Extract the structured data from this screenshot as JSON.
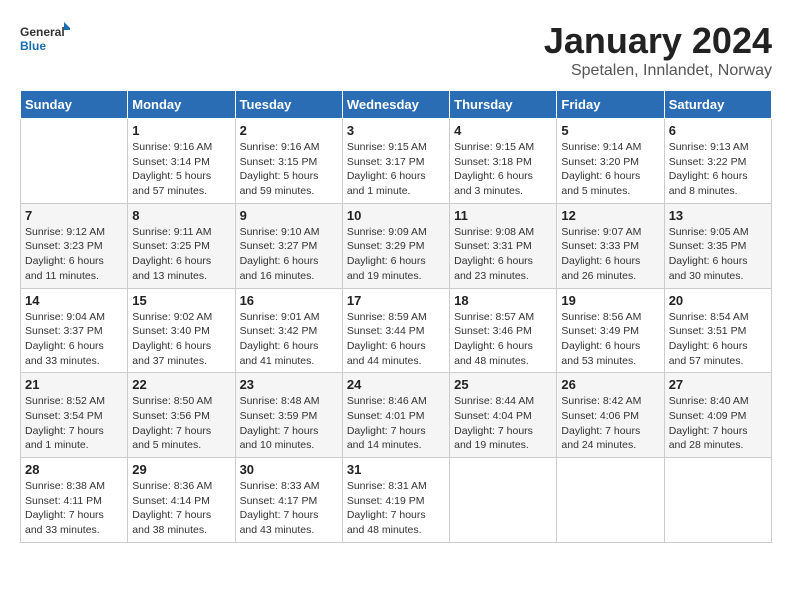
{
  "header": {
    "logo_general": "General",
    "logo_blue": "Blue",
    "title": "January 2024",
    "subtitle": "Spetalen, Innlandet, Norway"
  },
  "days_of_week": [
    "Sunday",
    "Monday",
    "Tuesday",
    "Wednesday",
    "Thursday",
    "Friday",
    "Saturday"
  ],
  "weeks": [
    [
      {
        "day": "",
        "info": ""
      },
      {
        "day": "1",
        "info": "Sunrise: 9:16 AM\nSunset: 3:14 PM\nDaylight: 5 hours\nand 57 minutes."
      },
      {
        "day": "2",
        "info": "Sunrise: 9:16 AM\nSunset: 3:15 PM\nDaylight: 5 hours\nand 59 minutes."
      },
      {
        "day": "3",
        "info": "Sunrise: 9:15 AM\nSunset: 3:17 PM\nDaylight: 6 hours\nand 1 minute."
      },
      {
        "day": "4",
        "info": "Sunrise: 9:15 AM\nSunset: 3:18 PM\nDaylight: 6 hours\nand 3 minutes."
      },
      {
        "day": "5",
        "info": "Sunrise: 9:14 AM\nSunset: 3:20 PM\nDaylight: 6 hours\nand 5 minutes."
      },
      {
        "day": "6",
        "info": "Sunrise: 9:13 AM\nSunset: 3:22 PM\nDaylight: 6 hours\nand 8 minutes."
      }
    ],
    [
      {
        "day": "7",
        "info": "Sunrise: 9:12 AM\nSunset: 3:23 PM\nDaylight: 6 hours\nand 11 minutes."
      },
      {
        "day": "8",
        "info": "Sunrise: 9:11 AM\nSunset: 3:25 PM\nDaylight: 6 hours\nand 13 minutes."
      },
      {
        "day": "9",
        "info": "Sunrise: 9:10 AM\nSunset: 3:27 PM\nDaylight: 6 hours\nand 16 minutes."
      },
      {
        "day": "10",
        "info": "Sunrise: 9:09 AM\nSunset: 3:29 PM\nDaylight: 6 hours\nand 19 minutes."
      },
      {
        "day": "11",
        "info": "Sunrise: 9:08 AM\nSunset: 3:31 PM\nDaylight: 6 hours\nand 23 minutes."
      },
      {
        "day": "12",
        "info": "Sunrise: 9:07 AM\nSunset: 3:33 PM\nDaylight: 6 hours\nand 26 minutes."
      },
      {
        "day": "13",
        "info": "Sunrise: 9:05 AM\nSunset: 3:35 PM\nDaylight: 6 hours\nand 30 minutes."
      }
    ],
    [
      {
        "day": "14",
        "info": "Sunrise: 9:04 AM\nSunset: 3:37 PM\nDaylight: 6 hours\nand 33 minutes."
      },
      {
        "day": "15",
        "info": "Sunrise: 9:02 AM\nSunset: 3:40 PM\nDaylight: 6 hours\nand 37 minutes."
      },
      {
        "day": "16",
        "info": "Sunrise: 9:01 AM\nSunset: 3:42 PM\nDaylight: 6 hours\nand 41 minutes."
      },
      {
        "day": "17",
        "info": "Sunrise: 8:59 AM\nSunset: 3:44 PM\nDaylight: 6 hours\nand 44 minutes."
      },
      {
        "day": "18",
        "info": "Sunrise: 8:57 AM\nSunset: 3:46 PM\nDaylight: 6 hours\nand 48 minutes."
      },
      {
        "day": "19",
        "info": "Sunrise: 8:56 AM\nSunset: 3:49 PM\nDaylight: 6 hours\nand 53 minutes."
      },
      {
        "day": "20",
        "info": "Sunrise: 8:54 AM\nSunset: 3:51 PM\nDaylight: 6 hours\nand 57 minutes."
      }
    ],
    [
      {
        "day": "21",
        "info": "Sunrise: 8:52 AM\nSunset: 3:54 PM\nDaylight: 7 hours\nand 1 minute."
      },
      {
        "day": "22",
        "info": "Sunrise: 8:50 AM\nSunset: 3:56 PM\nDaylight: 7 hours\nand 5 minutes."
      },
      {
        "day": "23",
        "info": "Sunrise: 8:48 AM\nSunset: 3:59 PM\nDaylight: 7 hours\nand 10 minutes."
      },
      {
        "day": "24",
        "info": "Sunrise: 8:46 AM\nSunset: 4:01 PM\nDaylight: 7 hours\nand 14 minutes."
      },
      {
        "day": "25",
        "info": "Sunrise: 8:44 AM\nSunset: 4:04 PM\nDaylight: 7 hours\nand 19 minutes."
      },
      {
        "day": "26",
        "info": "Sunrise: 8:42 AM\nSunset: 4:06 PM\nDaylight: 7 hours\nand 24 minutes."
      },
      {
        "day": "27",
        "info": "Sunrise: 8:40 AM\nSunset: 4:09 PM\nDaylight: 7 hours\nand 28 minutes."
      }
    ],
    [
      {
        "day": "28",
        "info": "Sunrise: 8:38 AM\nSunset: 4:11 PM\nDaylight: 7 hours\nand 33 minutes."
      },
      {
        "day": "29",
        "info": "Sunrise: 8:36 AM\nSunset: 4:14 PM\nDaylight: 7 hours\nand 38 minutes."
      },
      {
        "day": "30",
        "info": "Sunrise: 8:33 AM\nSunset: 4:17 PM\nDaylight: 7 hours\nand 43 minutes."
      },
      {
        "day": "31",
        "info": "Sunrise: 8:31 AM\nSunset: 4:19 PM\nDaylight: 7 hours\nand 48 minutes."
      },
      {
        "day": "",
        "info": ""
      },
      {
        "day": "",
        "info": ""
      },
      {
        "day": "",
        "info": ""
      }
    ]
  ]
}
